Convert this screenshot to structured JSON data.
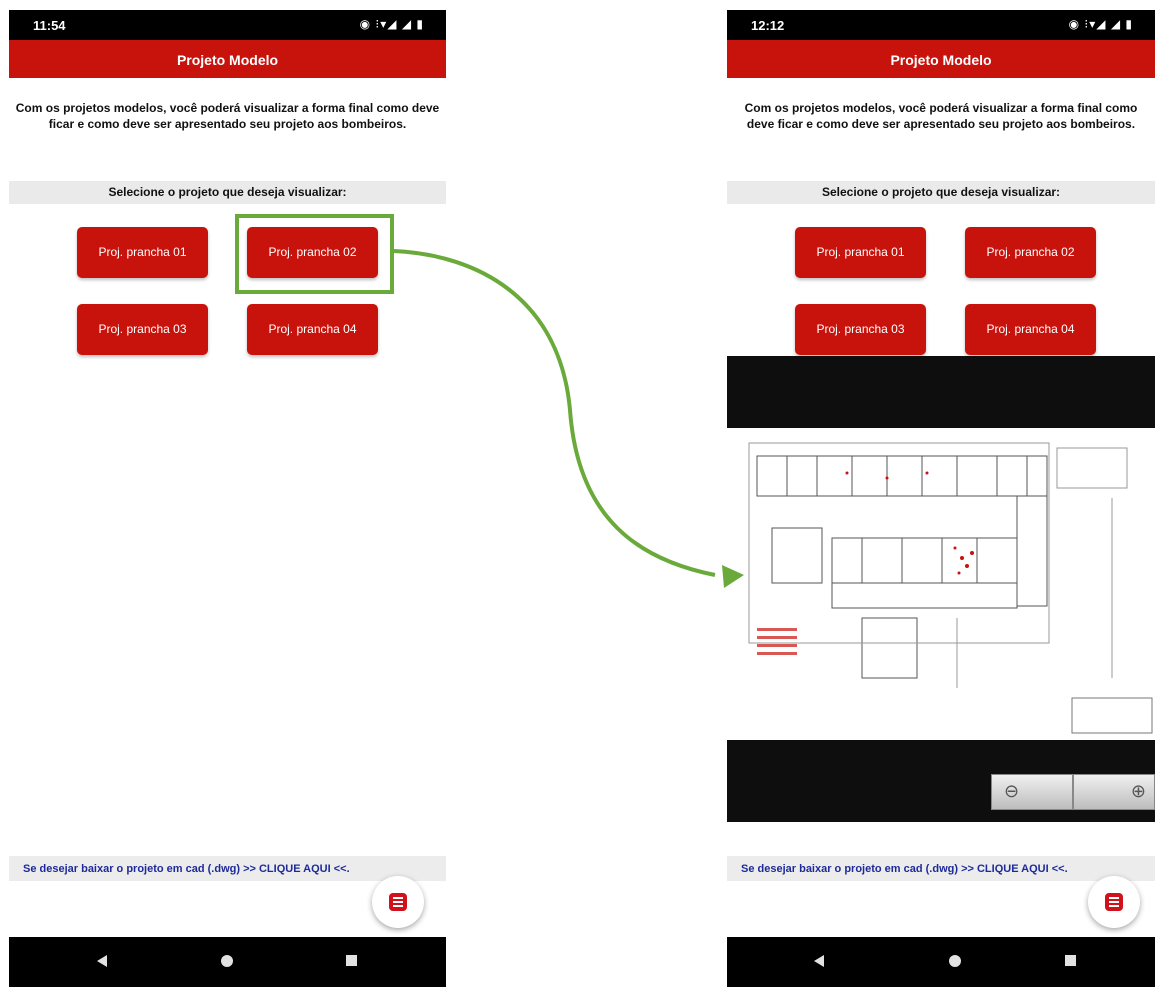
{
  "left_screen": {
    "status_time": "11:54",
    "app_title": "Projeto Modelo",
    "intro_text": "Com os projetos modelos, você poderá visualizar a forma final como deve ficar e como deve ser apresentado seu projeto aos bombeiros.",
    "select_label": "Selecione o projeto que deseja visualizar:",
    "buttons": [
      "Proj. prancha 01",
      "Proj. prancha 02",
      "Proj. prancha 03",
      "Proj. prancha 04"
    ],
    "download_text": "Se desejar baixar o projeto em cad (.dwg) >> CLIQUE AQUI <<."
  },
  "right_screen": {
    "status_time": "12:12",
    "app_title": "Projeto Modelo",
    "intro_text": "Com os projetos modelos, você poderá visualizar a forma final como deve ficar e como deve ser apresentado seu projeto aos bombeiros.",
    "select_label": "Selecione o projeto que deseja visualizar:",
    "buttons": [
      "Proj. prancha 01",
      "Proj. prancha 02",
      "Proj. prancha 03",
      "Proj. prancha 04"
    ],
    "download_text": "Se desejar baixar o projeto em cad (.dwg) >> CLIQUE AQUI <<.",
    "zoom_out_symbol": "⊖",
    "zoom_in_symbol": "⊕"
  },
  "status_icons": "◉ ⁝▾◢ ◢ ▮",
  "highlighted_button": "Proj. prancha 02",
  "colors": {
    "brand_red": "#c8120c",
    "highlight_green": "#6aaa3a",
    "link_blue": "#1e2a9a"
  }
}
